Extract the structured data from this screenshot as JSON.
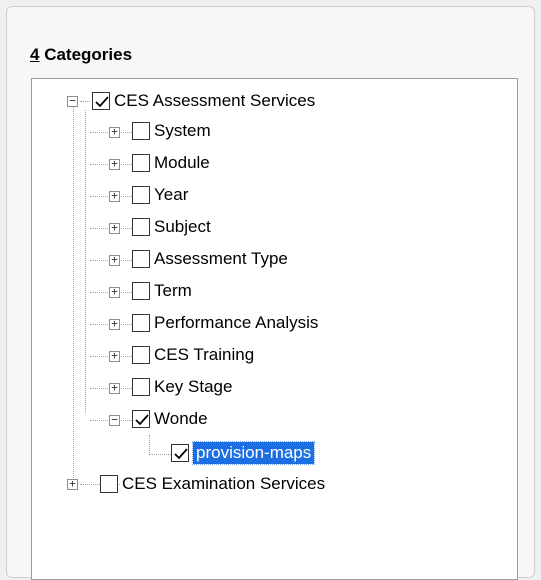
{
  "group": {
    "mnemonic": "4",
    "title_rest": " Categories"
  },
  "tree": {
    "root1": {
      "label": "CES Assessment Services",
      "checked": true,
      "expanded": true
    },
    "children": [
      {
        "label": "System",
        "checked": false,
        "expanded": false
      },
      {
        "label": "Module",
        "checked": false,
        "expanded": false
      },
      {
        "label": "Year",
        "checked": false,
        "expanded": false
      },
      {
        "label": "Subject",
        "checked": false,
        "expanded": false
      },
      {
        "label": "Assessment Type",
        "checked": false,
        "expanded": false
      },
      {
        "label": "Term",
        "checked": false,
        "expanded": false
      },
      {
        "label": "Performance Analysis",
        "checked": false,
        "expanded": false
      },
      {
        "label": "CES Training",
        "checked": false,
        "expanded": false
      },
      {
        "label": "Key Stage",
        "checked": false,
        "expanded": false
      },
      {
        "label": "Wonde",
        "checked": true,
        "expanded": true
      }
    ],
    "leaf": {
      "label": "provision-maps",
      "checked": true,
      "selected": true
    },
    "root2": {
      "label": "CES Examination Services",
      "checked": false,
      "expanded": false
    }
  },
  "icons": {
    "expand": "plus-box-icon",
    "collapse": "minus-box-icon",
    "check": "checkmark-icon"
  },
  "colors": {
    "selection": "#1c6fe3",
    "tree_line": "#a0a0a0"
  }
}
